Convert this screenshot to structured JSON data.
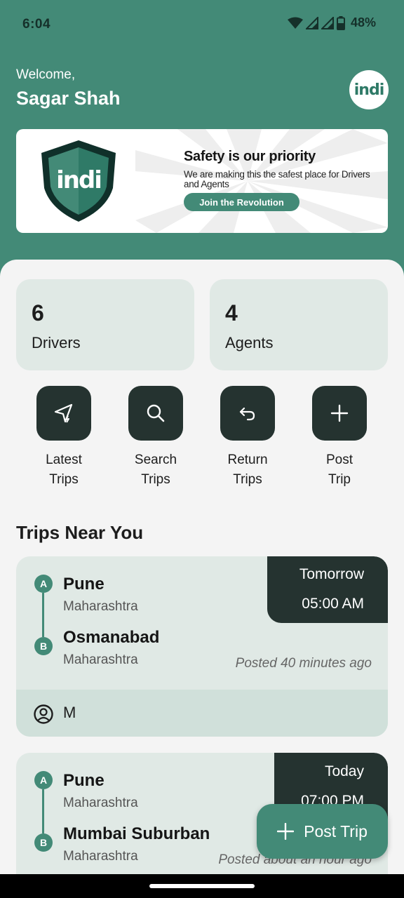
{
  "status_bar": {
    "time": "6:04",
    "battery": "48%"
  },
  "header": {
    "welcome": "Welcome,",
    "username": "Sagar Shah",
    "logo_text": "indi"
  },
  "banner": {
    "shield_text": "indi",
    "title": "Safety is our priority",
    "subtitle": "We are making this the safest place for Drivers and Agents",
    "button": "Join the Revolution"
  },
  "stats": [
    {
      "count": "6",
      "label": "Drivers"
    },
    {
      "count": "4",
      "label": "Agents"
    }
  ],
  "actions": [
    {
      "label": "Latest Trips",
      "icon": "send-icon"
    },
    {
      "label": "Search Trips",
      "icon": "search-icon"
    },
    {
      "label": "Return Trips",
      "icon": "return-icon"
    },
    {
      "label": "Post Trip",
      "icon": "plus-icon"
    }
  ],
  "section_title": "Trips Near You",
  "trips": [
    {
      "day": "Tomorrow",
      "time": "05:00 AM",
      "from_city": "Pune",
      "from_state": "Maharashtra",
      "to_city": "Osmanabad",
      "to_state": "Maharashtra",
      "posted": "Posted 40 minutes ago",
      "driver": "M",
      "pin_a": "A",
      "pin_b": "B"
    },
    {
      "day": "Today",
      "time": "07:00 PM",
      "from_city": "Pune",
      "from_state": "Maharashtra",
      "to_city": "Mumbai Suburban",
      "to_state": "Maharashtra",
      "posted": "Posted about an hour ago",
      "pin_a": "A",
      "pin_b": "B"
    }
  ],
  "fab": {
    "label": "Post Trip"
  },
  "colors": {
    "primary": "#438a77",
    "dark": "#253330",
    "card": "#e0e9e5"
  }
}
